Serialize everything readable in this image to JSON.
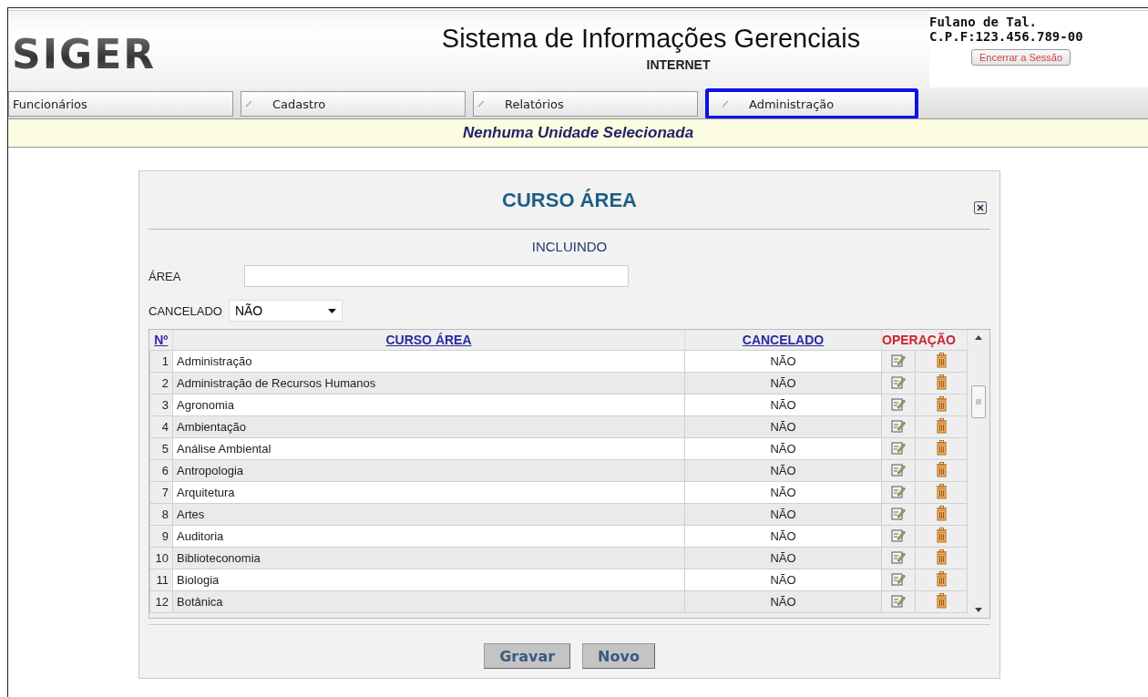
{
  "header": {
    "logo": "SIGER",
    "title": "Sistema de Informações Gerenciais",
    "subtitle": "INTERNET",
    "user_name": "Fulano de Tal.",
    "user_cpf": "C.P.F:123.456.789-00",
    "logout_button": "Encerrar a Sessão"
  },
  "tabs": [
    {
      "label": "Funcionários",
      "kind": "plain",
      "selected": false
    },
    {
      "label": "Cadastro",
      "kind": "pen",
      "selected": false
    },
    {
      "label": "Relatórios",
      "kind": "pen",
      "selected": false
    },
    {
      "label": "Administração",
      "kind": "pen",
      "selected": true
    }
  ],
  "notice": "Nenhuma Unidade Selecionada",
  "dialog": {
    "title": "CURSO ÁREA",
    "mode": "INCLUINDO",
    "fields": [
      {
        "kind": "text",
        "label": "ÁREA"
      },
      {
        "kind": "select",
        "label": "CANCELADO",
        "value": "NÃO"
      }
    ],
    "table": {
      "columns": [
        "Nº",
        "CURSO ÁREA",
        "CANCELADO",
        "OPERAÇÃO"
      ],
      "rows": [
        {
          "number": "1",
          "name": "Administração",
          "cancelled": "NÃO"
        },
        {
          "number": "2",
          "name": "Administração de Recursos Humanos",
          "cancelled": "NÃO"
        },
        {
          "number": "3",
          "name": "Agronomia",
          "cancelled": "NÃO"
        },
        {
          "number": "4",
          "name": "Ambientação",
          "cancelled": "NÃO"
        },
        {
          "number": "5",
          "name": "Análise Ambiental",
          "cancelled": "NÃO"
        },
        {
          "number": "6",
          "name": "Antropologia",
          "cancelled": "NÃO"
        },
        {
          "number": "7",
          "name": "Arquitetura",
          "cancelled": "NÃO"
        },
        {
          "number": "8",
          "name": "Artes",
          "cancelled": "NÃO"
        },
        {
          "number": "9",
          "name": "Auditoria",
          "cancelled": "NÃO"
        },
        {
          "number": "10",
          "name": "Biblioteconomia",
          "cancelled": "NÃO"
        },
        {
          "number": "11",
          "name": "Biologia",
          "cancelled": "NÃO"
        },
        {
          "number": "12",
          "name": "Botânica",
          "cancelled": "NÃO"
        }
      ]
    },
    "buttons": [
      "Gravar",
      "Novo"
    ]
  }
}
